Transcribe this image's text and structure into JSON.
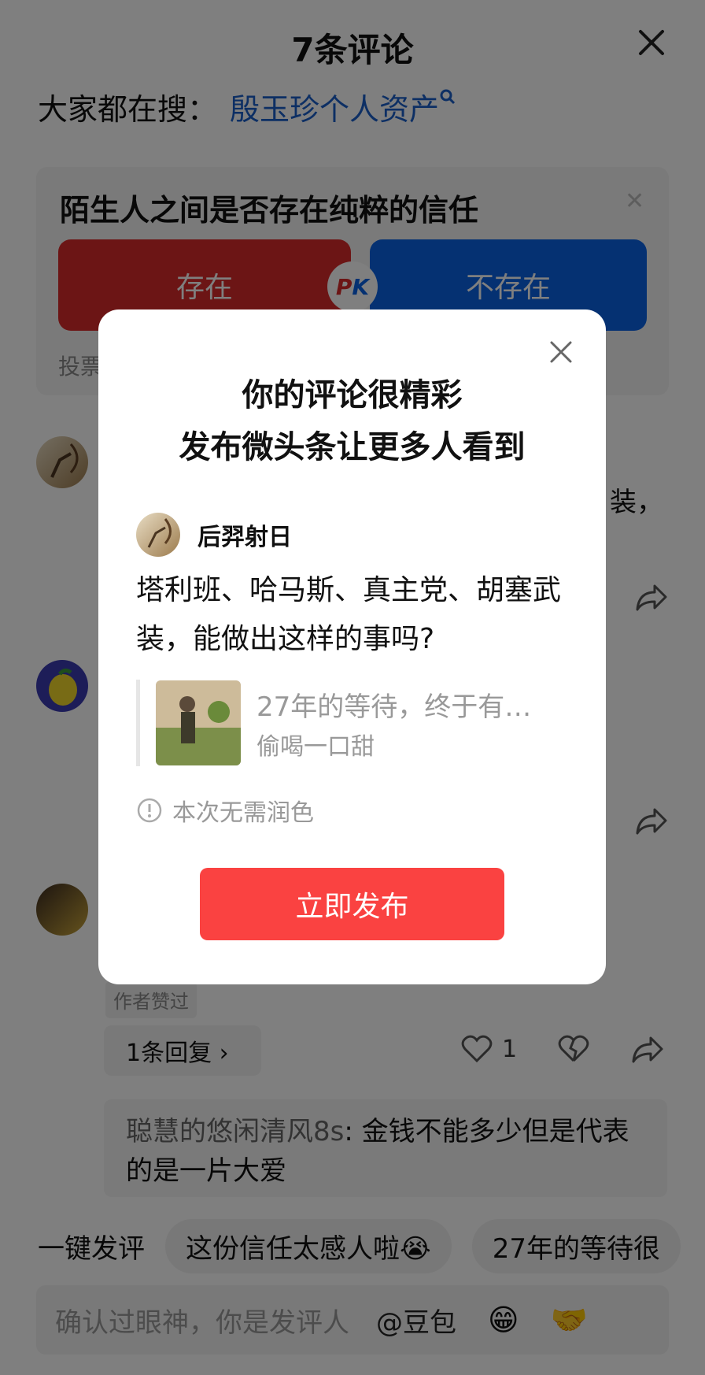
{
  "header": {
    "title": "7条评论"
  },
  "search": {
    "label": "大家都在搜：",
    "query": "殷玉珍个人资产"
  },
  "poll": {
    "question": "陌生人之间是否存在纯粹的信任",
    "option_a": "存在",
    "option_b": "不存在",
    "footer": "投票"
  },
  "background_comments": {
    "fragment": "装，",
    "author_tag": "作者赞过",
    "reply_count": "1条回复 ›",
    "like_count": "1",
    "quoted_reply": {
      "name": "聪慧的悠闲清风8s",
      "text": ": 金钱不能多少但是代表的是一片大爱"
    }
  },
  "quick_reply": {
    "label": "一键发评",
    "chips": [
      "这份信任太感人啦😭",
      "27年的等待很"
    ]
  },
  "input_bar": {
    "placeholder": "确认过眼神，你是发评人",
    "mention": "@豆包",
    "emoji": "😁",
    "emoji2": "🤝"
  },
  "modal": {
    "title_line1": "你的评论很精彩",
    "title_line2": "发布微头条让更多人看到",
    "username": "后羿射日",
    "comment_text": "塔利班、哈马斯、真主党、胡塞武装，能做出这样的事吗?",
    "card_title": "27年的等待，终于有…",
    "card_source": "偷喝一口甜",
    "note": "本次无需润色",
    "publish_button": "立即发布"
  },
  "colors": {
    "accent_red": "#fa4241",
    "link_blue": "#1a5fc9",
    "vote_red": "#d92b2b",
    "vote_blue": "#0b63e5"
  }
}
